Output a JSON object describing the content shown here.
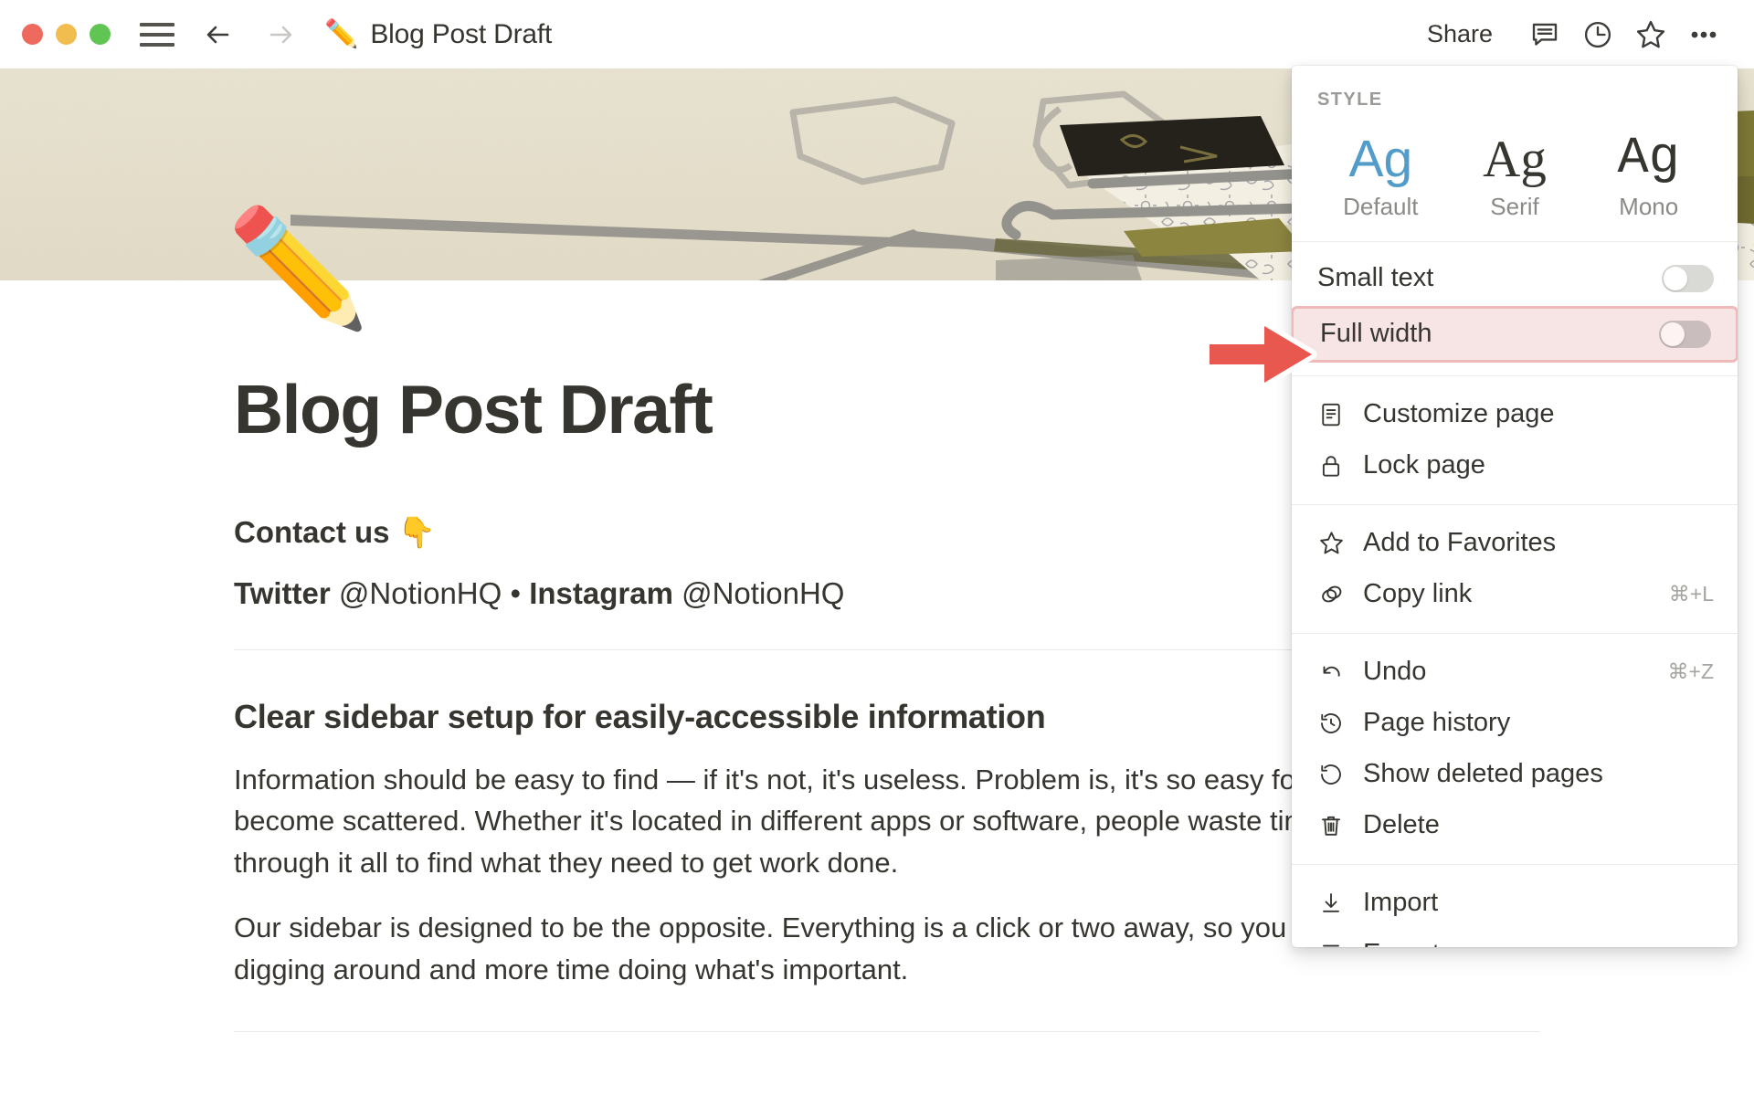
{
  "titlebar": {
    "window_controls": [
      "close",
      "minimize",
      "maximize"
    ],
    "sidebar_toggle": "hamburger-icon",
    "back": "arrow-left-icon",
    "forward": "arrow-right-icon",
    "page_emoji": "✏️",
    "title": "Blog Post Draft",
    "share_label": "Share",
    "icons": [
      "comment-icon",
      "clock-icon",
      "star-icon",
      "more-icon"
    ]
  },
  "cover": {
    "description": "japanese-woodblock-print-cover",
    "base_color": "#e5dfcc",
    "ink_color": "#9a9a95",
    "olive_color": "#7c7836",
    "dark_color": "#2f2d22"
  },
  "page": {
    "emoji": "✏️",
    "title": "Blog Post Draft",
    "contact_heading": "Contact us 👇",
    "contact_line": [
      {
        "bold": "Twitter",
        "normal": " @NotionHQ"
      },
      {
        "bold": "Instagram",
        "normal": " @NotionHQ"
      }
    ],
    "contact_separator": "•",
    "section_heading": "Clear sidebar setup for easily-accessible information",
    "paragraph_1": "Information should be easy to find — if it's not, it's useless. Problem is, it's so easy for information to become scattered. Whether it's located in different apps or software, people waste time searching through it all to find what they need to get work done.",
    "paragraph_2": "Our sidebar is designed to be the opposite. Everything is a click or two away, so you spend less time digging around and more time doing what's important."
  },
  "menu": {
    "style_label": "STYLE",
    "style_options": [
      {
        "sample": "Ag",
        "name": "Default",
        "selected": true,
        "color": "#529cca"
      },
      {
        "sample": "Ag",
        "name": "Serif",
        "selected": false,
        "color": "#37352f"
      },
      {
        "sample": "Ag",
        "name": "Mono",
        "selected": false,
        "color": "#37352f"
      }
    ],
    "toggles": [
      {
        "label": "Small text",
        "on": false,
        "highlighted": false
      },
      {
        "label": "Full width",
        "on": false,
        "highlighted": true
      }
    ],
    "group_1": [
      {
        "icon": "document-icon",
        "label": "Customize page",
        "shortcut": ""
      },
      {
        "icon": "lock-icon",
        "label": "Lock page",
        "shortcut": ""
      }
    ],
    "group_2": [
      {
        "icon": "star-icon",
        "label": "Add to Favorites",
        "shortcut": ""
      },
      {
        "icon": "link-icon",
        "label": "Copy link",
        "shortcut": "⌘+L"
      }
    ],
    "group_3": [
      {
        "icon": "undo-icon",
        "label": "Undo",
        "shortcut": "⌘+Z"
      },
      {
        "icon": "history-icon",
        "label": "Page history",
        "shortcut": ""
      },
      {
        "icon": "restore-icon",
        "label": "Show deleted pages",
        "shortcut": ""
      },
      {
        "icon": "trash-icon",
        "label": "Delete",
        "shortcut": ""
      }
    ],
    "group_4": [
      {
        "icon": "import-icon",
        "label": "Import",
        "shortcut": ""
      },
      {
        "icon": "export-icon",
        "label": "Export",
        "shortcut": ""
      }
    ]
  },
  "annotation": {
    "arrow": "red-right-arrow",
    "arrow_color": "#e8584f",
    "target": "Full width",
    "highlight_border": "#f0b9b9",
    "highlight_fill": "#f7e4e4"
  }
}
